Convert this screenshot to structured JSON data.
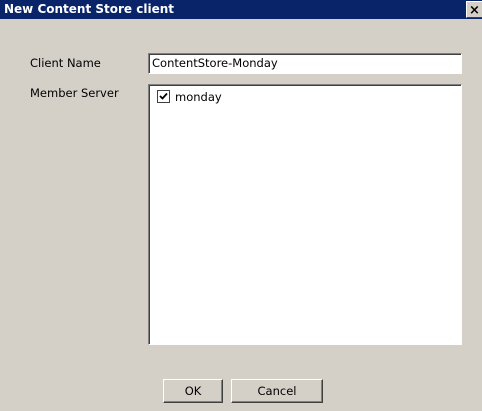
{
  "window": {
    "title": "New Content Store client",
    "close_glyph": "×"
  },
  "form": {
    "client_name_label": "Client Name",
    "client_name_value": "ContentStore-Monday",
    "member_server_label": "Member Server",
    "member_servers": [
      {
        "label": "monday",
        "checked": true
      }
    ]
  },
  "buttons": {
    "ok_label": "OK",
    "cancel_label": "Cancel"
  }
}
